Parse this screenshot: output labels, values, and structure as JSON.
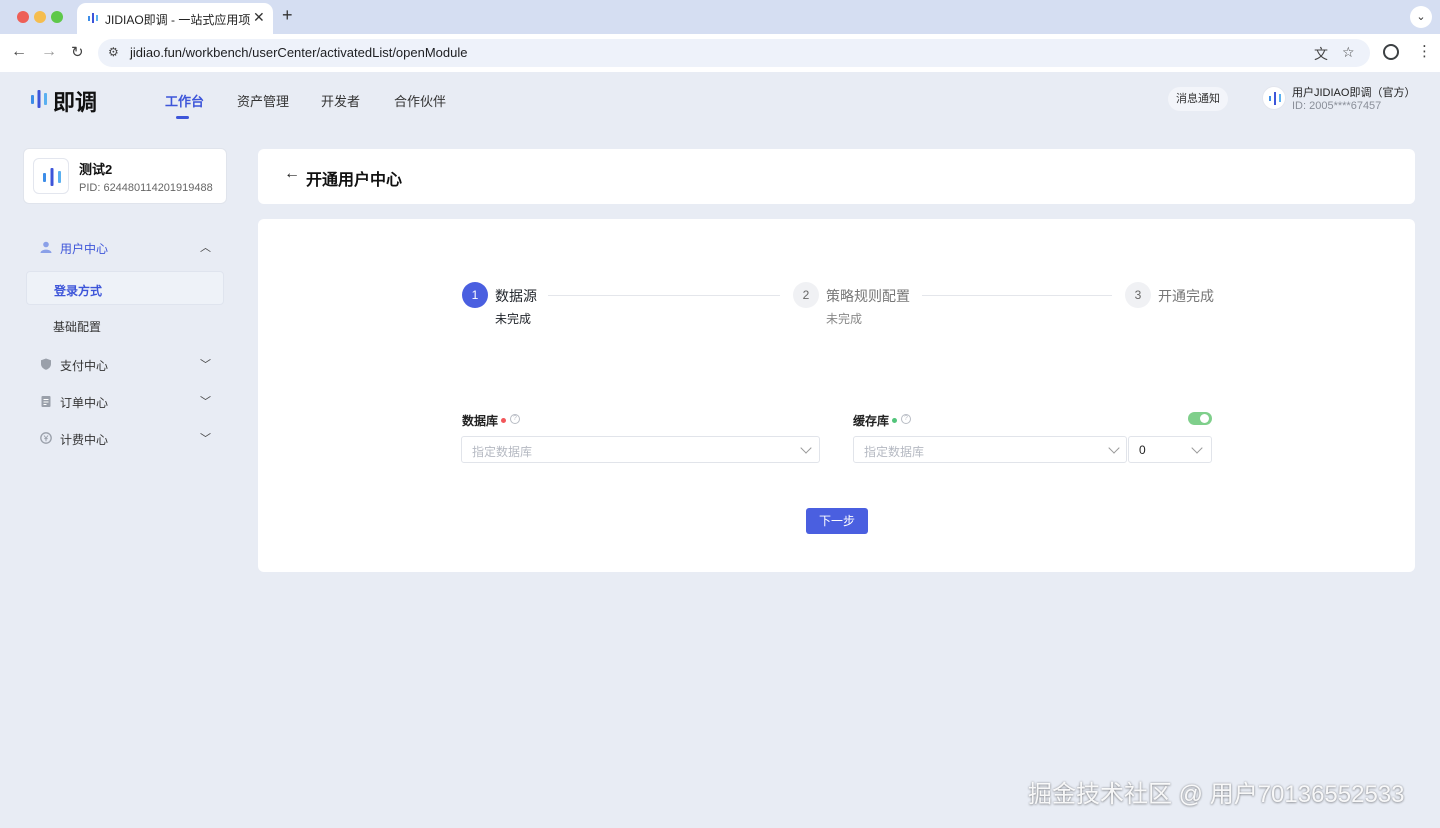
{
  "browser": {
    "tab_title": "JIDIAO即调 - 一站式应用项目管理平台",
    "tab_close": "✕",
    "new_tab": "+",
    "url_host": "jidiao.fun",
    "url_path": "/workbench/userCenter/activatedList/openModule"
  },
  "header": {
    "logo_text": "即调",
    "nav": [
      {
        "label": "工作台",
        "active": true
      },
      {
        "label": "资产管理"
      },
      {
        "label": "开发者"
      },
      {
        "label": "合作伙伴"
      }
    ],
    "notify_label": "消息通知",
    "user_name": "用户JIDIAO即调（官方）",
    "user_id": "ID: 2005****67457"
  },
  "project": {
    "name": "测试2",
    "pid": "PID: 624480114201919488"
  },
  "sidebar": {
    "groups": [
      {
        "label": "用户中心",
        "icon": "user-icon",
        "open": true,
        "items": [
          {
            "label": "登录方式",
            "active": true
          },
          {
            "label": "基础配置"
          }
        ]
      },
      {
        "label": "支付中心",
        "icon": "shield-icon"
      },
      {
        "label": "订单中心",
        "icon": "clipboard-icon"
      },
      {
        "label": "计费中心",
        "icon": "currency-icon"
      }
    ]
  },
  "page": {
    "title": "开通用户中心",
    "steps": [
      {
        "num": "1",
        "title": "数据源",
        "desc": "未完成",
        "status": "active"
      },
      {
        "num": "2",
        "title": "策略规则配置",
        "desc": "未完成",
        "status": "pending"
      },
      {
        "num": "3",
        "title": "开通完成",
        "desc": "",
        "status": "pending"
      }
    ],
    "database": {
      "label": "数据库",
      "placeholder": "指定数据库",
      "dot_color": "#f2575a"
    },
    "cache": {
      "label": "缓存库",
      "placeholder": "指定数据库",
      "index_value": "0",
      "dot_color": "#52c47a",
      "enabled": true
    },
    "next_button": "下一步"
  },
  "colors": {
    "accent": "#4a5fe0",
    "page_bg": "#e8ecf4"
  },
  "watermark": "掘金技术社区 @ 用户70136552533"
}
